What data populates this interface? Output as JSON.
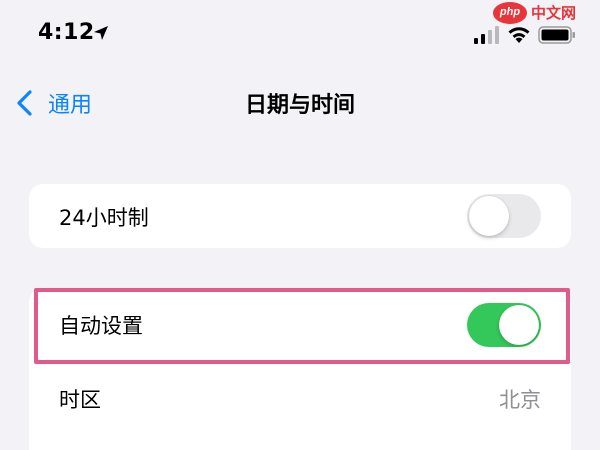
{
  "status_bar": {
    "time": "4:12",
    "icons": [
      "location-arrow-icon",
      "cellular-signal-icon",
      "wifi-icon",
      "battery-icon"
    ]
  },
  "watermark": {
    "logo_text": "php",
    "text": "中文网",
    "color": "#e8343b"
  },
  "nav": {
    "back_label": "通用",
    "title": "日期与时间"
  },
  "settings": {
    "hour24": {
      "label": "24小时制",
      "enabled": false
    },
    "auto_set": {
      "label": "自动设置",
      "enabled": true
    },
    "time_zone": {
      "label": "时区",
      "value": "北京"
    }
  },
  "colors": {
    "accent": "#0a84ff",
    "toggle_on": "#34c759",
    "toggle_off": "#e9e9eb",
    "highlight": "#e05a8a",
    "background": "#f2f2f7"
  }
}
